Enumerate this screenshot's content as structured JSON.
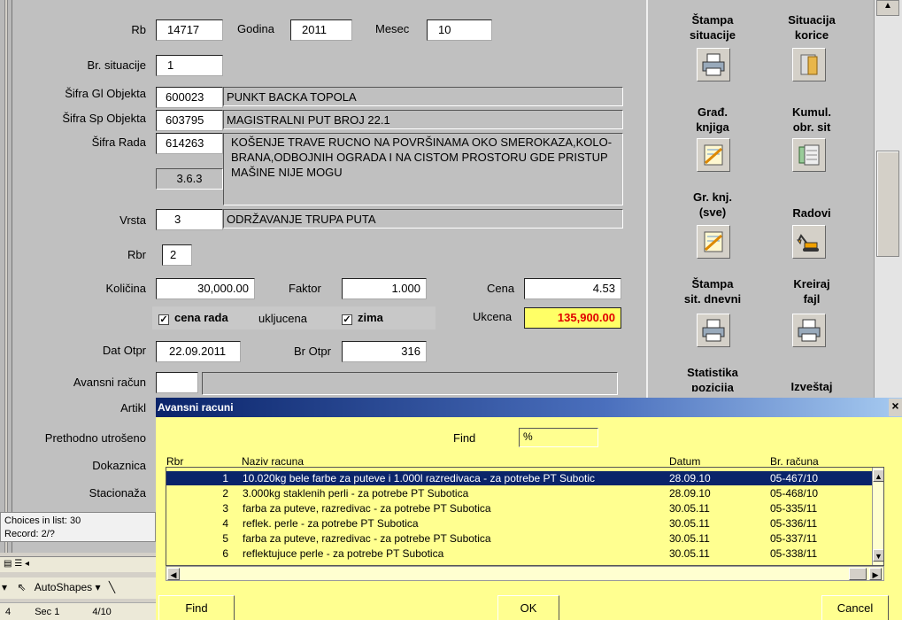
{
  "form": {
    "rb": {
      "label": "Rb",
      "value": "14717"
    },
    "godina": {
      "label": "Godina",
      "value": "2011"
    },
    "mesec": {
      "label": "Mesec",
      "value": "10"
    },
    "br_situacije": {
      "label": "Br. situacije",
      "value": "1"
    },
    "sifra_gl": {
      "label": "Šifra Gl Objekta",
      "code": "600023",
      "name": "PUNKT BACKA TOPOLA"
    },
    "sifra_sp": {
      "label": "Šifra Sp Objekta",
      "code": "603795",
      "name": "MAGISTRALNI PUT BROJ 22.1"
    },
    "sifra_rada": {
      "label": "Šifra Rada",
      "code": "614263",
      "subcode": "3.6.3",
      "description": "KOŠENJE TRAVE RUCNO NA POVRŠINAMA OKO SMEROKAZA,KOLO- BRANA,ODBOJNIH OGRADA I NA CISTOM PROSTORU GDE PRISTUP MAŠINE NIJE MOGU"
    },
    "vrsta": {
      "label": "Vrsta",
      "code": "3",
      "name": "ODRŽAVANJE TRUPA PUTA"
    },
    "rbr": {
      "label": "Rbr",
      "value": "2"
    },
    "kolicina": {
      "label": "Količina",
      "value": "30,000.00"
    },
    "faktor": {
      "label": "Faktor",
      "value": "1.000"
    },
    "cena": {
      "label": "Cena",
      "value": "4.53"
    },
    "cena_rada": {
      "label": "cena rada",
      "checked": "✓"
    },
    "ukljucena": "ukljucena",
    "zima": {
      "label": "zima",
      "checked": "✓"
    },
    "ukcena": {
      "label": "Ukcena",
      "value": "135,900.00"
    },
    "dat_otpr": {
      "label": "Dat Otpr",
      "value": "22.09.2011"
    },
    "br_otpr": {
      "label": "Br Otpr",
      "value": "316"
    },
    "avansni": {
      "label": "Avansni račun"
    },
    "artikl": {
      "label": "Artikl"
    },
    "prethodno": {
      "label": "Prethodno utrošeno"
    },
    "dokaznica": {
      "label": "Dokaznica"
    },
    "stacionaza": {
      "label": "Stacionaža"
    }
  },
  "right_buttons": [
    {
      "label1": "Štampa",
      "label2": "situacije",
      "icon": "printer-icon"
    },
    {
      "label1": "Situacija",
      "label2": "korice",
      "icon": "folder-icon"
    },
    {
      "label1": "Građ.",
      "label2": "knjiga",
      "icon": "notepad-icon"
    },
    {
      "label1": "Kumul.",
      "label2": "obr. sit",
      "icon": "spreadsheet-icon"
    },
    {
      "label1": "Gr. knj.",
      "label2": "(sve)",
      "icon": "notepad-icon"
    },
    {
      "label1": "Radovi",
      "label2": "",
      "icon": "excavator-icon"
    },
    {
      "label1": "Štampa",
      "label2": "sit. dnevni",
      "icon": "printer-icon"
    },
    {
      "label1": "Kreiraj",
      "label2": "fajl",
      "icon": "printer-icon"
    },
    {
      "label1": "Statistika",
      "label2": "pozicija",
      "icon": ""
    },
    {
      "label1": "Izveštaj",
      "label2": "",
      "icon": ""
    }
  ],
  "status": {
    "choices": "Choices in list: 30",
    "record": "Record: 2/?"
  },
  "taskbar": {
    "autoshapes": "AutoShapes ▾",
    "page": "4",
    "sec": "Sec 1",
    "pages": "4/10"
  },
  "dialog": {
    "title": "Avansni racuni",
    "close": "×",
    "find_label": "Find",
    "find_value": "%",
    "columns": [
      "Rbr",
      "Naziv racuna",
      "Datum",
      "Br. računa"
    ],
    "rows": [
      [
        "1",
        "10.020kg bele farbe za puteve i 1.000l razredivaca - za potrebe PT Subotic",
        "28.09.10",
        "05-467/10"
      ],
      [
        "2",
        "3.000kg staklenih perli - za potrebe PT Subotica",
        "28.09.10",
        "05-468/10"
      ],
      [
        "3",
        "farba za puteve,  razredivac  - za potrebe PT Subotica",
        "30.05.11",
        "05-335/11"
      ],
      [
        "4",
        " reflek. perle - za potrebe PT Subotica",
        "30.05.11",
        "05-336/11"
      ],
      [
        "5",
        "farba za puteve, razredivac  - za potrebe PT Subotica",
        "30.05.11",
        "05-337/11"
      ],
      [
        "6",
        "reflektujuce perle - za potrebe PT Subotica",
        "30.05.11",
        "05-338/11"
      ]
    ],
    "find_button": "Find",
    "ok_button": "OK",
    "cancel_button": "Cancel"
  }
}
